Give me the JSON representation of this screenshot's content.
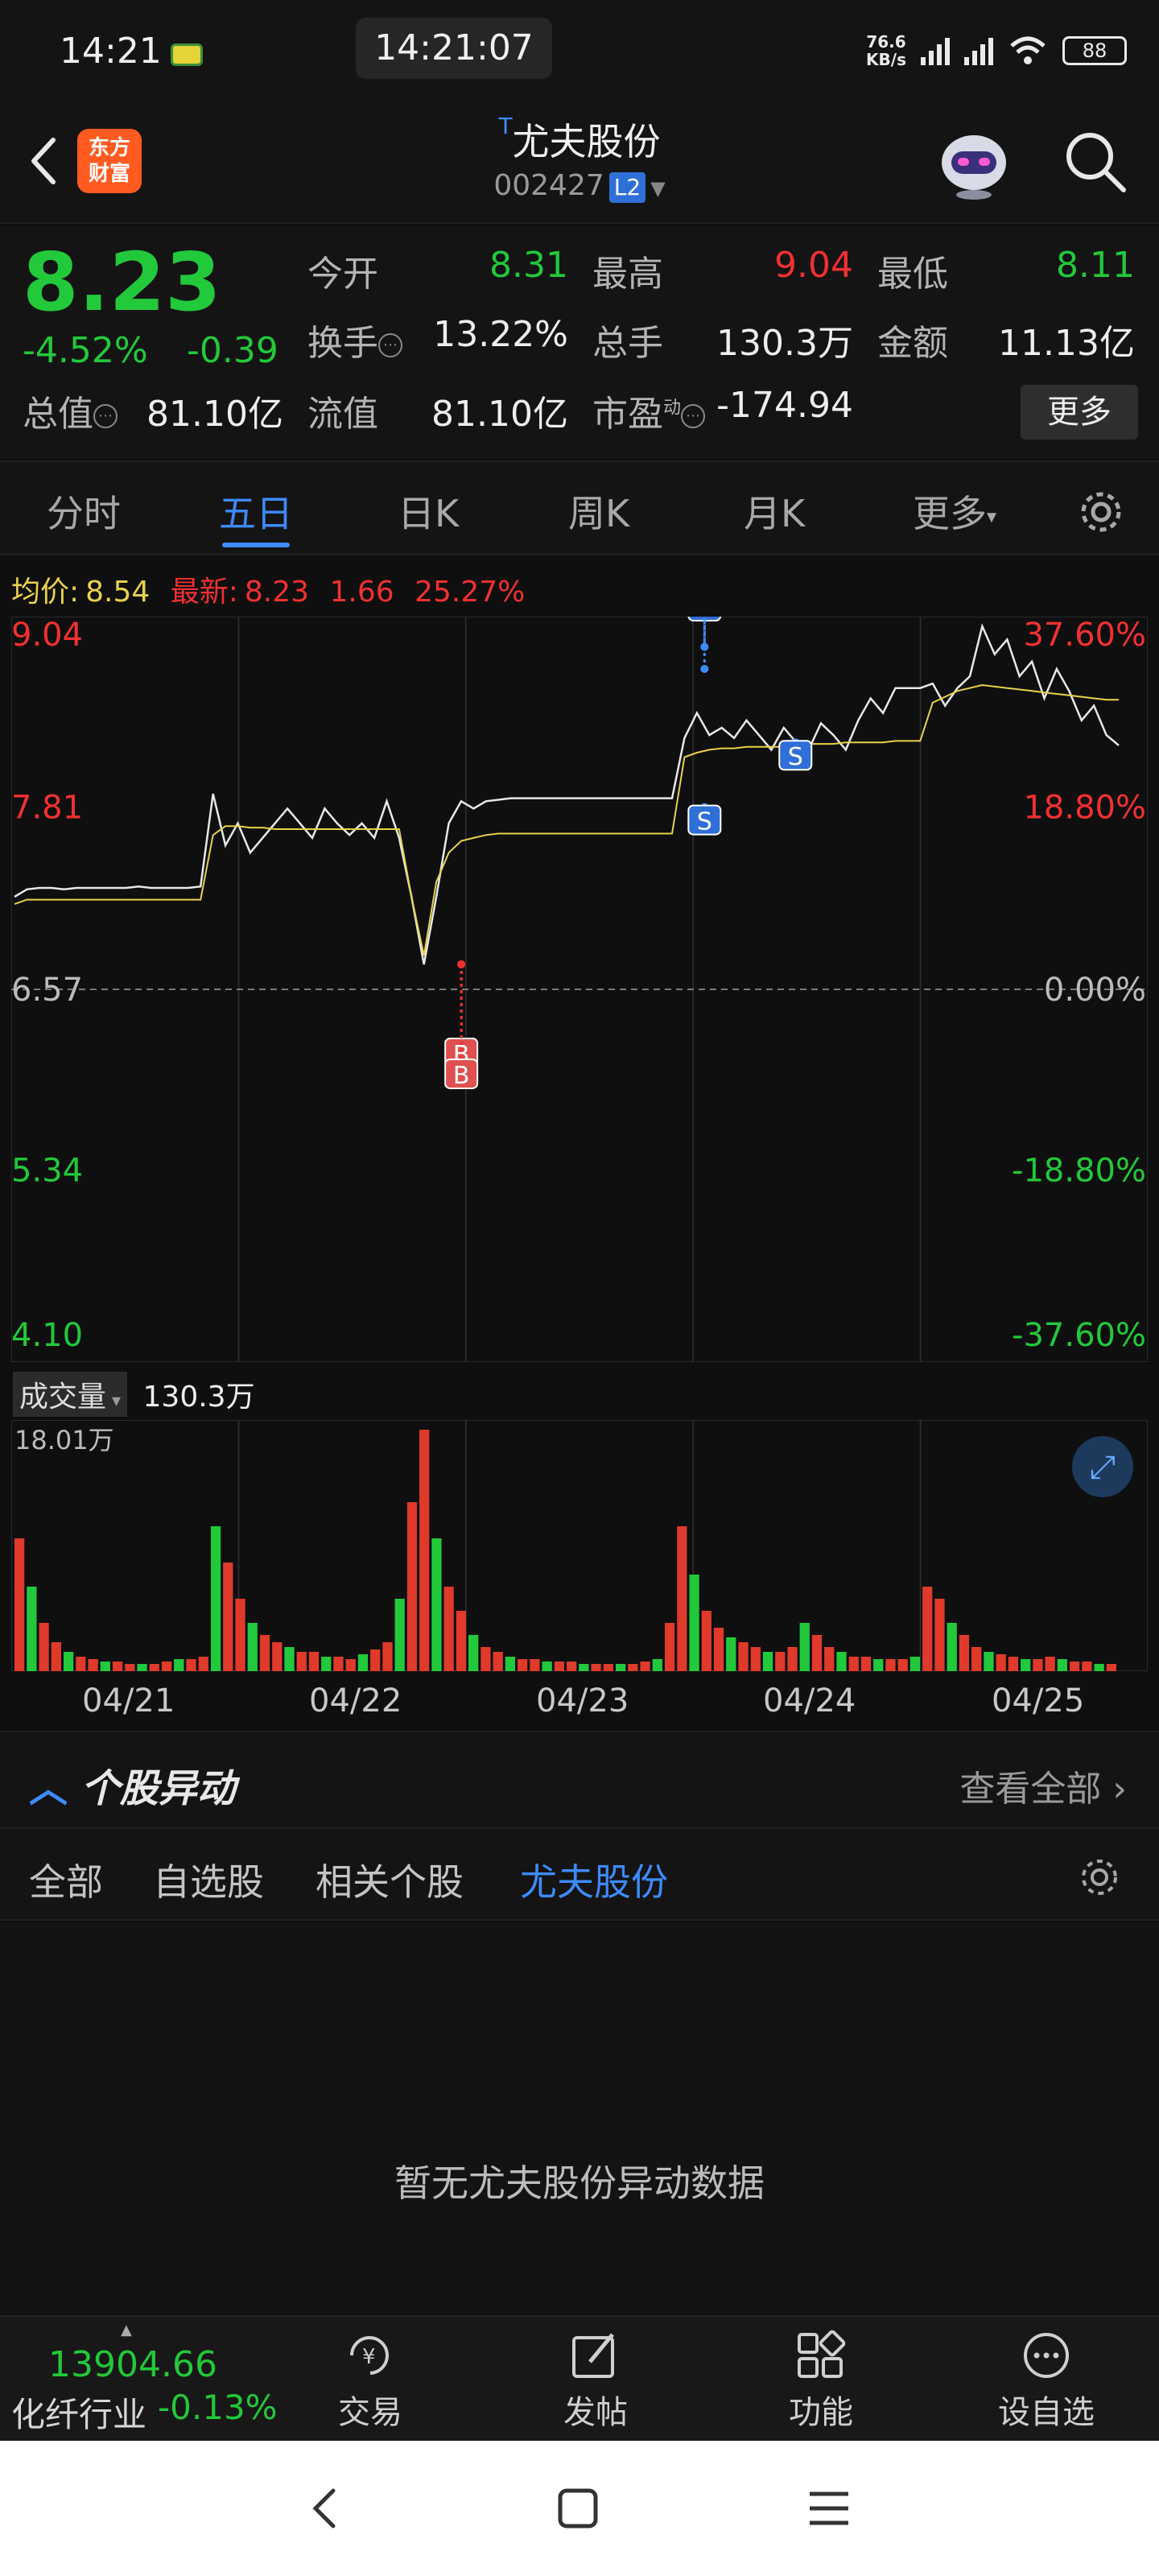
{
  "status": {
    "time": "14:21",
    "center_time": "14:21:07",
    "net_speed_value": "76.6",
    "net_speed_unit": "KB/s",
    "battery": "88"
  },
  "header": {
    "app_logo_line1": "东方",
    "app_logo_line2": "财富",
    "t_mark": "T",
    "stock_name": "尤夫股份",
    "stock_code": "002427",
    "level_badge": "L2"
  },
  "quote": {
    "price": "8.23",
    "change_pct": "-4.52%",
    "change_amt": "-0.39",
    "fields": {
      "open_label": "今开",
      "open": "8.31",
      "high_label": "最高",
      "high": "9.04",
      "low_label": "最低",
      "low": "8.11",
      "turnover_label": "换手",
      "turnover": "13.22%",
      "volume_label": "总手",
      "volume": "130.3万",
      "amount_label": "金额",
      "amount": "11.13亿",
      "mktcap_label": "总值",
      "mktcap": "81.10亿",
      "float_label": "流值",
      "float": "81.10亿",
      "pe_label": "市盈",
      "pe_sup": "动",
      "pe": "-174.94"
    },
    "more_label": "更多"
  },
  "tabs": [
    "分时",
    "五日",
    "日K",
    "周K",
    "月K",
    "更多"
  ],
  "active_tab": "五日",
  "chart_header": {
    "avg_label": "均价:",
    "avg_value": "8.54",
    "latest_label": "最新:",
    "latest_value": "8.23",
    "latest_chg": "1.66",
    "latest_pct": "25.27%"
  },
  "chart_data": {
    "type": "line",
    "title": "",
    "y_left_ticks": [
      "9.04",
      "7.81",
      "6.57",
      "5.34",
      "4.10"
    ],
    "y_right_ticks": [
      "37.60%",
      "18.80%",
      "0.00%",
      "-18.80%",
      "-37.60%"
    ],
    "ylim": [
      4.1,
      9.04
    ],
    "baseline": 6.57,
    "x_categories": [
      "04/21",
      "04/22",
      "04/23",
      "04/24",
      "04/25"
    ],
    "series": [
      {
        "values": [
          7.2,
          7.25,
          7.26,
          7.26,
          7.25,
          7.26,
          7.26,
          7.26,
          7.26,
          7.26,
          7.27,
          7.26,
          7.26,
          7.26,
          7.26,
          7.27,
          7.9,
          7.55,
          7.7,
          7.5,
          7.6,
          7.7,
          7.8,
          7.7,
          7.6,
          7.8,
          7.7,
          7.62,
          7.7,
          7.6,
          7.85,
          7.6,
          7.2,
          6.74,
          7.2,
          7.7,
          7.85,
          7.8,
          7.85,
          7.86,
          7.87,
          7.87,
          7.87,
          7.87,
          7.87,
          7.87,
          7.87,
          7.87,
          7.87,
          7.87,
          7.87,
          7.87,
          7.87,
          7.87,
          8.28,
          8.45,
          8.3,
          8.35,
          8.28,
          8.4,
          8.3,
          8.2,
          8.35,
          8.25,
          8.2,
          8.38,
          8.3,
          8.2,
          8.4,
          8.55,
          8.45,
          8.62,
          8.62,
          8.62,
          8.65,
          8.5,
          8.62,
          8.7,
          9.04,
          8.85,
          8.95,
          8.7,
          8.8,
          8.55,
          8.75,
          8.6,
          8.4,
          8.5,
          8.3,
          8.23
        ]
      },
      {
        "values": [
          7.15,
          7.18,
          7.18,
          7.18,
          7.18,
          7.18,
          7.18,
          7.18,
          7.18,
          7.18,
          7.18,
          7.18,
          7.18,
          7.18,
          7.18,
          7.18,
          7.62,
          7.68,
          7.68,
          7.67,
          7.67,
          7.66,
          7.66,
          7.66,
          7.66,
          7.66,
          7.66,
          7.66,
          7.66,
          7.66,
          7.66,
          7.66,
          7.2,
          6.8,
          7.3,
          7.5,
          7.58,
          7.6,
          7.62,
          7.63,
          7.63,
          7.63,
          7.63,
          7.63,
          7.63,
          7.63,
          7.63,
          7.63,
          7.63,
          7.63,
          7.63,
          7.63,
          7.63,
          7.63,
          8.15,
          8.18,
          8.2,
          8.21,
          8.21,
          8.22,
          8.22,
          8.22,
          8.22,
          8.24,
          8.24,
          8.24,
          8.24,
          8.25,
          8.25,
          8.25,
          8.25,
          8.26,
          8.26,
          8.26,
          8.52,
          8.56,
          8.6,
          8.62,
          8.64,
          8.63,
          8.62,
          8.61,
          8.6,
          8.59,
          8.58,
          8.57,
          8.56,
          8.55,
          8.54,
          8.54
        ]
      }
    ],
    "trade_marks": [
      {
        "label": "B",
        "day": 1,
        "frac": 0.98,
        "price": 6.74
      },
      {
        "label": "B",
        "day": 1,
        "frac": 0.98,
        "price": 6.74
      },
      {
        "label": "S",
        "day": 3,
        "frac": 0.05,
        "price": 7.81
      },
      {
        "label": "S",
        "day": 3,
        "frac": 0.05,
        "price": 8.75
      },
      {
        "label": "S",
        "day": 3,
        "frac": 0.05,
        "price": 8.9
      },
      {
        "label": "S",
        "day": 3,
        "frac": 0.45,
        "price": 8.25
      }
    ],
    "grid": true
  },
  "volume": {
    "label": "成交量",
    "total": "130.3万",
    "max_label": "18.01万",
    "bars": [
      0.55,
      0.35,
      0.2,
      0.12,
      0.08,
      0.06,
      0.05,
      0.04,
      0.04,
      0.03,
      0.03,
      0.03,
      0.04,
      0.05,
      0.05,
      0.06,
      0.6,
      0.45,
      0.3,
      0.2,
      0.15,
      0.12,
      0.1,
      0.08,
      0.08,
      0.06,
      0.06,
      0.05,
      0.07,
      0.09,
      0.12,
      0.3,
      0.7,
      1.0,
      0.55,
      0.35,
      0.25,
      0.15,
      0.1,
      0.08,
      0.06,
      0.05,
      0.05,
      0.04,
      0.04,
      0.04,
      0.03,
      0.03,
      0.03,
      0.03,
      0.03,
      0.04,
      0.05,
      0.2,
      0.6,
      0.4,
      0.25,
      0.18,
      0.14,
      0.12,
      0.1,
      0.08,
      0.08,
      0.1,
      0.2,
      0.15,
      0.1,
      0.08,
      0.06,
      0.06,
      0.05,
      0.05,
      0.05,
      0.06,
      0.35,
      0.3,
      0.2,
      0.15,
      0.1,
      0.08,
      0.07,
      0.06,
      0.05,
      0.05,
      0.06,
      0.05,
      0.04,
      0.04,
      0.03,
      0.03
    ]
  },
  "abnormal": {
    "title": "个股异动",
    "view_all": "查看全部",
    "filters": [
      "全部",
      "自选股",
      "相关个股",
      "尤夫股份"
    ],
    "active_filter": "尤夫股份",
    "empty_text": "暂无尤夫股份异动数据"
  },
  "bottom_bar": {
    "index_value": "13904.66",
    "index_name": "化纤行业",
    "index_pct": "-0.13%",
    "nav": [
      "交易",
      "发帖",
      "功能",
      "设自选"
    ]
  }
}
